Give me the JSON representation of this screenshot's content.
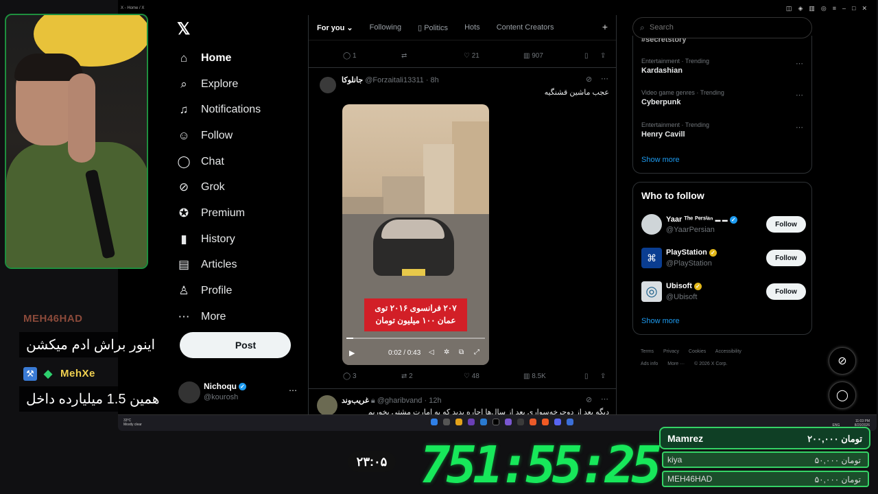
{
  "window": {
    "title": "X - Home / X"
  },
  "nav": {
    "items": [
      {
        "label": "Home",
        "icon": "home-icon"
      },
      {
        "label": "Explore",
        "icon": "search-icon"
      },
      {
        "label": "Notifications",
        "icon": "bell-icon"
      },
      {
        "label": "Follow",
        "icon": "person-add-icon"
      },
      {
        "label": "Chat",
        "icon": "chat-icon"
      },
      {
        "label": "Grok",
        "icon": "grok-icon"
      },
      {
        "label": "Premium",
        "icon": "premium-icon"
      },
      {
        "label": "History",
        "icon": "bookmark-icon"
      },
      {
        "label": "Articles",
        "icon": "articles-icon"
      },
      {
        "label": "Profile",
        "icon": "profile-icon"
      },
      {
        "label": "More",
        "icon": "more-icon"
      }
    ],
    "post_label": "Post"
  },
  "account": {
    "name": "Nichoqu",
    "handle": "@kourosh"
  },
  "tabs": [
    "For you",
    "Following",
    "Politics",
    "Hots",
    "Content Creators"
  ],
  "first_tweet_actions": {
    "replies": "1",
    "likes": "21",
    "views": "907"
  },
  "tweet1": {
    "name": "جانلوکا",
    "handle": "@Forzaitali13311",
    "time": "8h",
    "text": "عجب ماشین قشنگیه",
    "caption_line1": "۲۰۷ فرانسوی ۲۰۱۶ توی",
    "caption_line2": "عمان ۱۰۰ میلیون تومان",
    "video_time": "0:02 / 0:43",
    "progress_percent": 5,
    "replies": "3",
    "retweets": "2",
    "likes": "48",
    "views": "8.5K"
  },
  "tweet2": {
    "name": "غریب‌وند",
    "handle": "@gharibvand",
    "time": "12h",
    "text": "دیگه بعد از دوچرخه‌سواری بعد از سال‌ها اجاره بدید که به امارت مشتی بخوریم"
  },
  "search": {
    "placeholder": "Search"
  },
  "trends": {
    "top_partial": "#secretstory",
    "items": [
      {
        "category": "Entertainment · Trending",
        "name": "Kardashian"
      },
      {
        "category": "Video game genres · Trending",
        "name": "Cyberpunk"
      },
      {
        "category": "Entertainment · Trending",
        "name": "Henry Cavill"
      }
    ],
    "show_more": "Show more"
  },
  "who_to_follow": {
    "title": "Who to follow",
    "items": [
      {
        "name": "Yaar ᵀʰᵉ ᴾᵉʳˢⁱᵃⁿ",
        "handle": "@YaarPersian",
        "badge": "blue",
        "avatar_color": "#cfd5d8"
      },
      {
        "name": "PlayStation",
        "handle": "@PlayStation",
        "badge": "gold",
        "avatar_color": "#0a3d91"
      },
      {
        "name": "Ubisoft",
        "handle": "@Ubisoft",
        "badge": "gold",
        "avatar_color": "#d9dee2"
      }
    ],
    "follow_label": "Follow",
    "show_more": "Show more"
  },
  "footer": {
    "links": [
      "Terms",
      "Privacy",
      "Cookies",
      "Accessibility",
      "Ads info",
      "More ···",
      "© 2026 X Corp."
    ]
  },
  "taskbar": {
    "temp": "33°C",
    "weather": "Mostly clear",
    "lang": "ENG",
    "time": "11:03 PM",
    "date": "8/20/2026"
  },
  "stream": {
    "chat": [
      {
        "user": "MEH46HAD",
        "message": "اینور براش ادم میکشن",
        "color": "#8b4a3a"
      },
      {
        "user": "MehXe",
        "message": "همین 1.5 میلیارده داخل",
        "color": "#f0d050"
      }
    ],
    "timer_small": "۲۳:۰۵",
    "timer_big": "751:55:25",
    "donations": {
      "top": {
        "name": "Mamrez",
        "amount": "تومان ۲۰۰,۰۰۰"
      },
      "rows": [
        {
          "name": "kiya",
          "amount": "تومان ۵۰,۰۰۰"
        },
        {
          "name": "MEH46HAD",
          "amount": "تومان ۵۰,۰۰۰"
        }
      ]
    }
  },
  "colors": {
    "accent": "#1d9bf0",
    "timer": "#17e85a",
    "donation_border": "#35d366"
  }
}
